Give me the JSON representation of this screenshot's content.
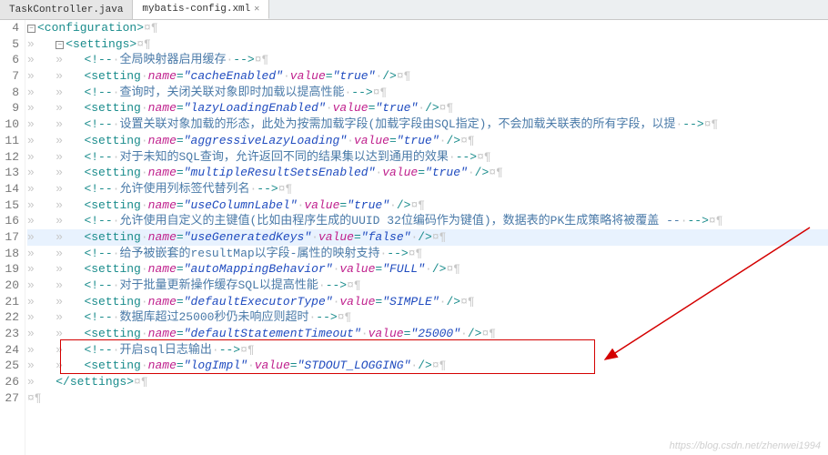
{
  "tabs": [
    {
      "label": "TaskController.java",
      "active": false
    },
    {
      "label": "mybatis-config.xml",
      "active": true
    }
  ],
  "lines": {
    "4": {
      "indent": "",
      "collapse": "-",
      "text_tag_open": "<configuration>"
    },
    "5": {
      "indent": "    ",
      "collapse": "-",
      "text_tag_open": "<settings>"
    },
    "6": {
      "indent": "        ",
      "comment": "全局映射器启用缓存"
    },
    "7": {
      "indent": "        ",
      "name": "cacheEnabled",
      "value": "true"
    },
    "8": {
      "indent": "        ",
      "comment": "查询时，关闭关联对象即时加载以提高性能"
    },
    "9": {
      "indent": "        ",
      "name": "lazyLoadingEnabled",
      "value": "true"
    },
    "10": {
      "indent": "        ",
      "comment": "设置关联对象加载的形态，此处为按需加载字段(加载字段由SQL指定)，不会加载关联表的所有字段，以提"
    },
    "11": {
      "indent": "        ",
      "name": "aggressiveLazyLoading",
      "value": "true"
    },
    "12": {
      "indent": "        ",
      "comment": "对于未知的SQL查询，允许返回不同的结果集以达到通用的效果"
    },
    "13": {
      "indent": "        ",
      "name": "multipleResultSetsEnabled",
      "value": "true"
    },
    "14": {
      "indent": "        ",
      "comment": "允许使用列标签代替列名"
    },
    "15": {
      "indent": "        ",
      "name": "useColumnLabel",
      "value": "true"
    },
    "16": {
      "indent": "        ",
      "comment": "允许使用自定义的主键值(比如由程序生成的UUID 32位编码作为键值)，数据表的PK生成策略将被覆盖 --"
    },
    "17": {
      "indent": "        ",
      "name": "useGeneratedKeys",
      "value": "false",
      "hl": true
    },
    "18": {
      "indent": "        ",
      "comment": "给予被嵌套的resultMap以字段-属性的映射支持"
    },
    "19": {
      "indent": "        ",
      "name": "autoMappingBehavior",
      "value": "FULL"
    },
    "20": {
      "indent": "        ",
      "comment": "对于批量更新操作缓存SQL以提高性能"
    },
    "21": {
      "indent": "        ",
      "name": "defaultExecutorType",
      "value": "SIMPLE"
    },
    "22": {
      "indent": "        ",
      "comment": "数据库超过25000秒仍未响应则超时"
    },
    "23": {
      "indent": "        ",
      "name": "defaultStatementTimeout",
      "value": "25000"
    },
    "24": {
      "indent": "        ",
      "comment": "开启sql日志输出"
    },
    "25": {
      "indent": "        ",
      "name": "logImpl",
      "value": "STDOUT_LOGGING"
    },
    "26": {
      "indent": "    ",
      "text_tag_close": "</settings>"
    },
    "27": {
      "indent": "",
      "blank": true
    }
  },
  "tokens": {
    "setting_open": "<setting",
    "name_attr": "name",
    "value_attr": "value",
    "self_close": "/>",
    "eq": "=",
    "q": "\"",
    "comment_open": "<!-- ",
    "comment_close": " -->",
    "ws_dot": "·",
    "ws_raquo": "»",
    "pilcrow": "¶",
    "currency": "¤"
  },
  "watermark": "https://blog.csdn.net/zhenwei1994"
}
